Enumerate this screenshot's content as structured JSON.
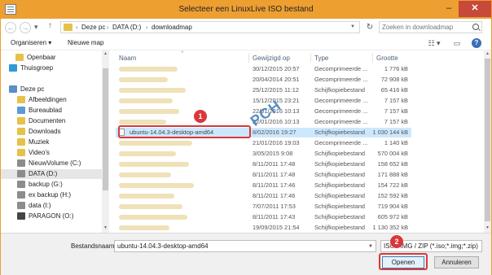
{
  "window": {
    "title": "Selecteer een LinuxLive ISO bestand"
  },
  "controls": {
    "minimize": "–",
    "close": "✕"
  },
  "nav": {
    "back": "←",
    "forward": "→",
    "up": "↑",
    "crumbs": [
      "Deze pc",
      "DATA (D:)",
      "downloadmap"
    ],
    "refresh": "↻",
    "search_placeholder": "Zoeken in downloadmap"
  },
  "toolbar": {
    "organize": "Organiseren ▾",
    "new_folder": "Nieuwe map",
    "view_icon": "view-menu-icon",
    "pane_icon": "preview-pane-icon",
    "help": "?"
  },
  "sidebar": {
    "items": [
      {
        "label": "Openbaar",
        "icon": "folder-icon",
        "color": "#e7c14b"
      },
      {
        "label": "Thuisgroep",
        "icon": "homegroup-icon",
        "color": "#2f9ad6"
      },
      {
        "label": "Deze pc",
        "icon": "computer-icon",
        "color": "#5a8fc8"
      },
      {
        "label": "Afbeeldingen",
        "icon": "pictures-folder-icon",
        "color": "#e7c14b"
      },
      {
        "label": "Bureaublad",
        "icon": "desktop-folder-icon",
        "color": "#5b9bd5"
      },
      {
        "label": "Documenten",
        "icon": "documents-folder-icon",
        "color": "#e7c14b"
      },
      {
        "label": "Downloads",
        "icon": "downloads-folder-icon",
        "color": "#e7c14b"
      },
      {
        "label": "Muziek",
        "icon": "music-folder-icon",
        "color": "#e7c14b"
      },
      {
        "label": "Video's",
        "icon": "videos-folder-icon",
        "color": "#e7c14b"
      },
      {
        "label": "NieuwVolume (C:)",
        "icon": "drive-icon",
        "color": "#8c8c8c"
      },
      {
        "label": "DATA (D:)",
        "icon": "drive-icon",
        "color": "#8c8c8c",
        "selected": true
      },
      {
        "label": "backup (G:)",
        "icon": "drive-icon",
        "color": "#8c8c8c"
      },
      {
        "label": "ex backup (H:)",
        "icon": "drive-icon",
        "color": "#8c8c8c"
      },
      {
        "label": "data (I:)",
        "icon": "drive-icon",
        "color": "#8c8c8c"
      },
      {
        "label": "PARAGON (O:)",
        "icon": "drive-icon",
        "color": "#444444"
      }
    ]
  },
  "columns": {
    "name": "Naam",
    "date": "Gewijzigd op",
    "type": "Type",
    "size": "Grootte"
  },
  "files": [
    {
      "name": "",
      "date": "30/12/2015 20:57",
      "type": "Gecomprimeerde ...",
      "size": "1 776 kB"
    },
    {
      "name": "",
      "date": "20/04/2014 20:51",
      "type": "Gecomprimeerde ...",
      "size": "72 908 kB"
    },
    {
      "name": "",
      "date": "25/12/2015 11:12",
      "type": "Schijfkopiebestand",
      "size": "65 416 kB"
    },
    {
      "name": "",
      "date": "15/12/2015 23:21",
      "type": "Gecomprimeerde ...",
      "size": "7 157 kB"
    },
    {
      "name": "",
      "date": "22/01/2016 10:13",
      "type": "Gecomprimeerde ...",
      "size": "7 157 kB"
    },
    {
      "name": "",
      "date": "22/01/2016 10:13",
      "type": "Gecomprimeerde ...",
      "size": "7 157 kB"
    },
    {
      "name": "ubuntu-14.04.3-desktop-amd64",
      "date": "8/02/2016 19:27",
      "type": "Schijfkopiebestand",
      "size": "1 030 144 kB",
      "selected": true
    },
    {
      "name": "",
      "date": "21/01/2016 19:03",
      "type": "Gecomprimeerde ...",
      "size": "1 140 kB"
    },
    {
      "name": "",
      "date": "3/05/2015 9:08",
      "type": "Schijfkopiebestand",
      "size": "570 004 kB"
    },
    {
      "name": "",
      "date": "8/11/2011 17:48",
      "type": "Schijfkopiebestand",
      "size": "158 652 kB"
    },
    {
      "name": "",
      "date": "8/11/2011 17:48",
      "type": "Schijfkopiebestand",
      "size": "171 888 kB"
    },
    {
      "name": "",
      "date": "8/11/2011 17:46",
      "type": "Schijfkopiebestand",
      "size": "154 722 kB"
    },
    {
      "name": "",
      "date": "8/11/2011 17:46",
      "type": "Schijfkopiebestand",
      "size": "152 592 kB"
    },
    {
      "name": "",
      "date": "7/07/2011 17:53",
      "type": "Schijfkopiebestand",
      "size": "719 904 kB"
    },
    {
      "name": "",
      "date": "8/11/2011 17:43",
      "type": "Schijfkopiebestand",
      "size": "605 972 kB"
    },
    {
      "name": "",
      "date": "19/09/2015 21:54",
      "type": "Schijfkopiebestand",
      "size": "1 130 352 kB"
    }
  ],
  "bottom": {
    "filename_label": "Bestandsnaam:",
    "filename_value": "ubuntu-14.04.3-desktop-amd64",
    "filetype": "ISO / IMG / ZIP (*.iso;*.img;*.zip)",
    "open": "Openen",
    "cancel": "Annuleren"
  },
  "annotations": {
    "badge1": "1",
    "badge2": "2",
    "watermark": "PCH"
  },
  "colors": {
    "titlebar": "#ed9f32",
    "highlight": "#d9383a",
    "selection": "#cce8ff"
  }
}
